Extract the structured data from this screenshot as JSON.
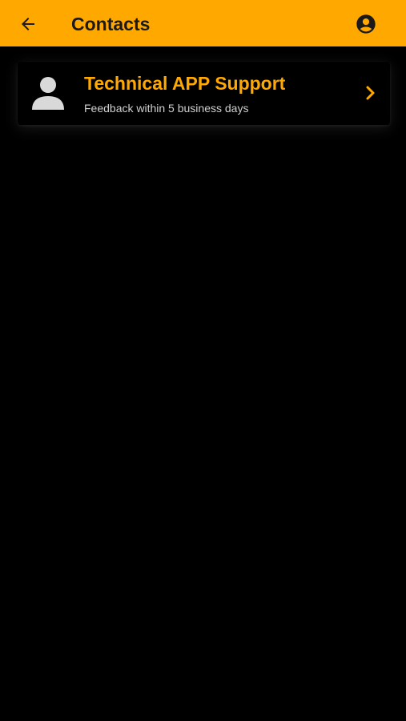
{
  "header": {
    "title": "Contacts",
    "back_icon": "arrow-left-icon",
    "account_icon": "account-circle-icon"
  },
  "contacts": [
    {
      "title": "Technical APP Support",
      "subtitle": "Feedback within 5 business days",
      "avatar_icon": "person-icon",
      "chevron_icon": "chevron-right-icon"
    }
  ],
  "colors": {
    "accent": "#FFA800",
    "background": "#000000",
    "header_text": "#1a1a1a",
    "subtitle_text": "#cfcfcf",
    "avatar": "#d9d9d9"
  }
}
